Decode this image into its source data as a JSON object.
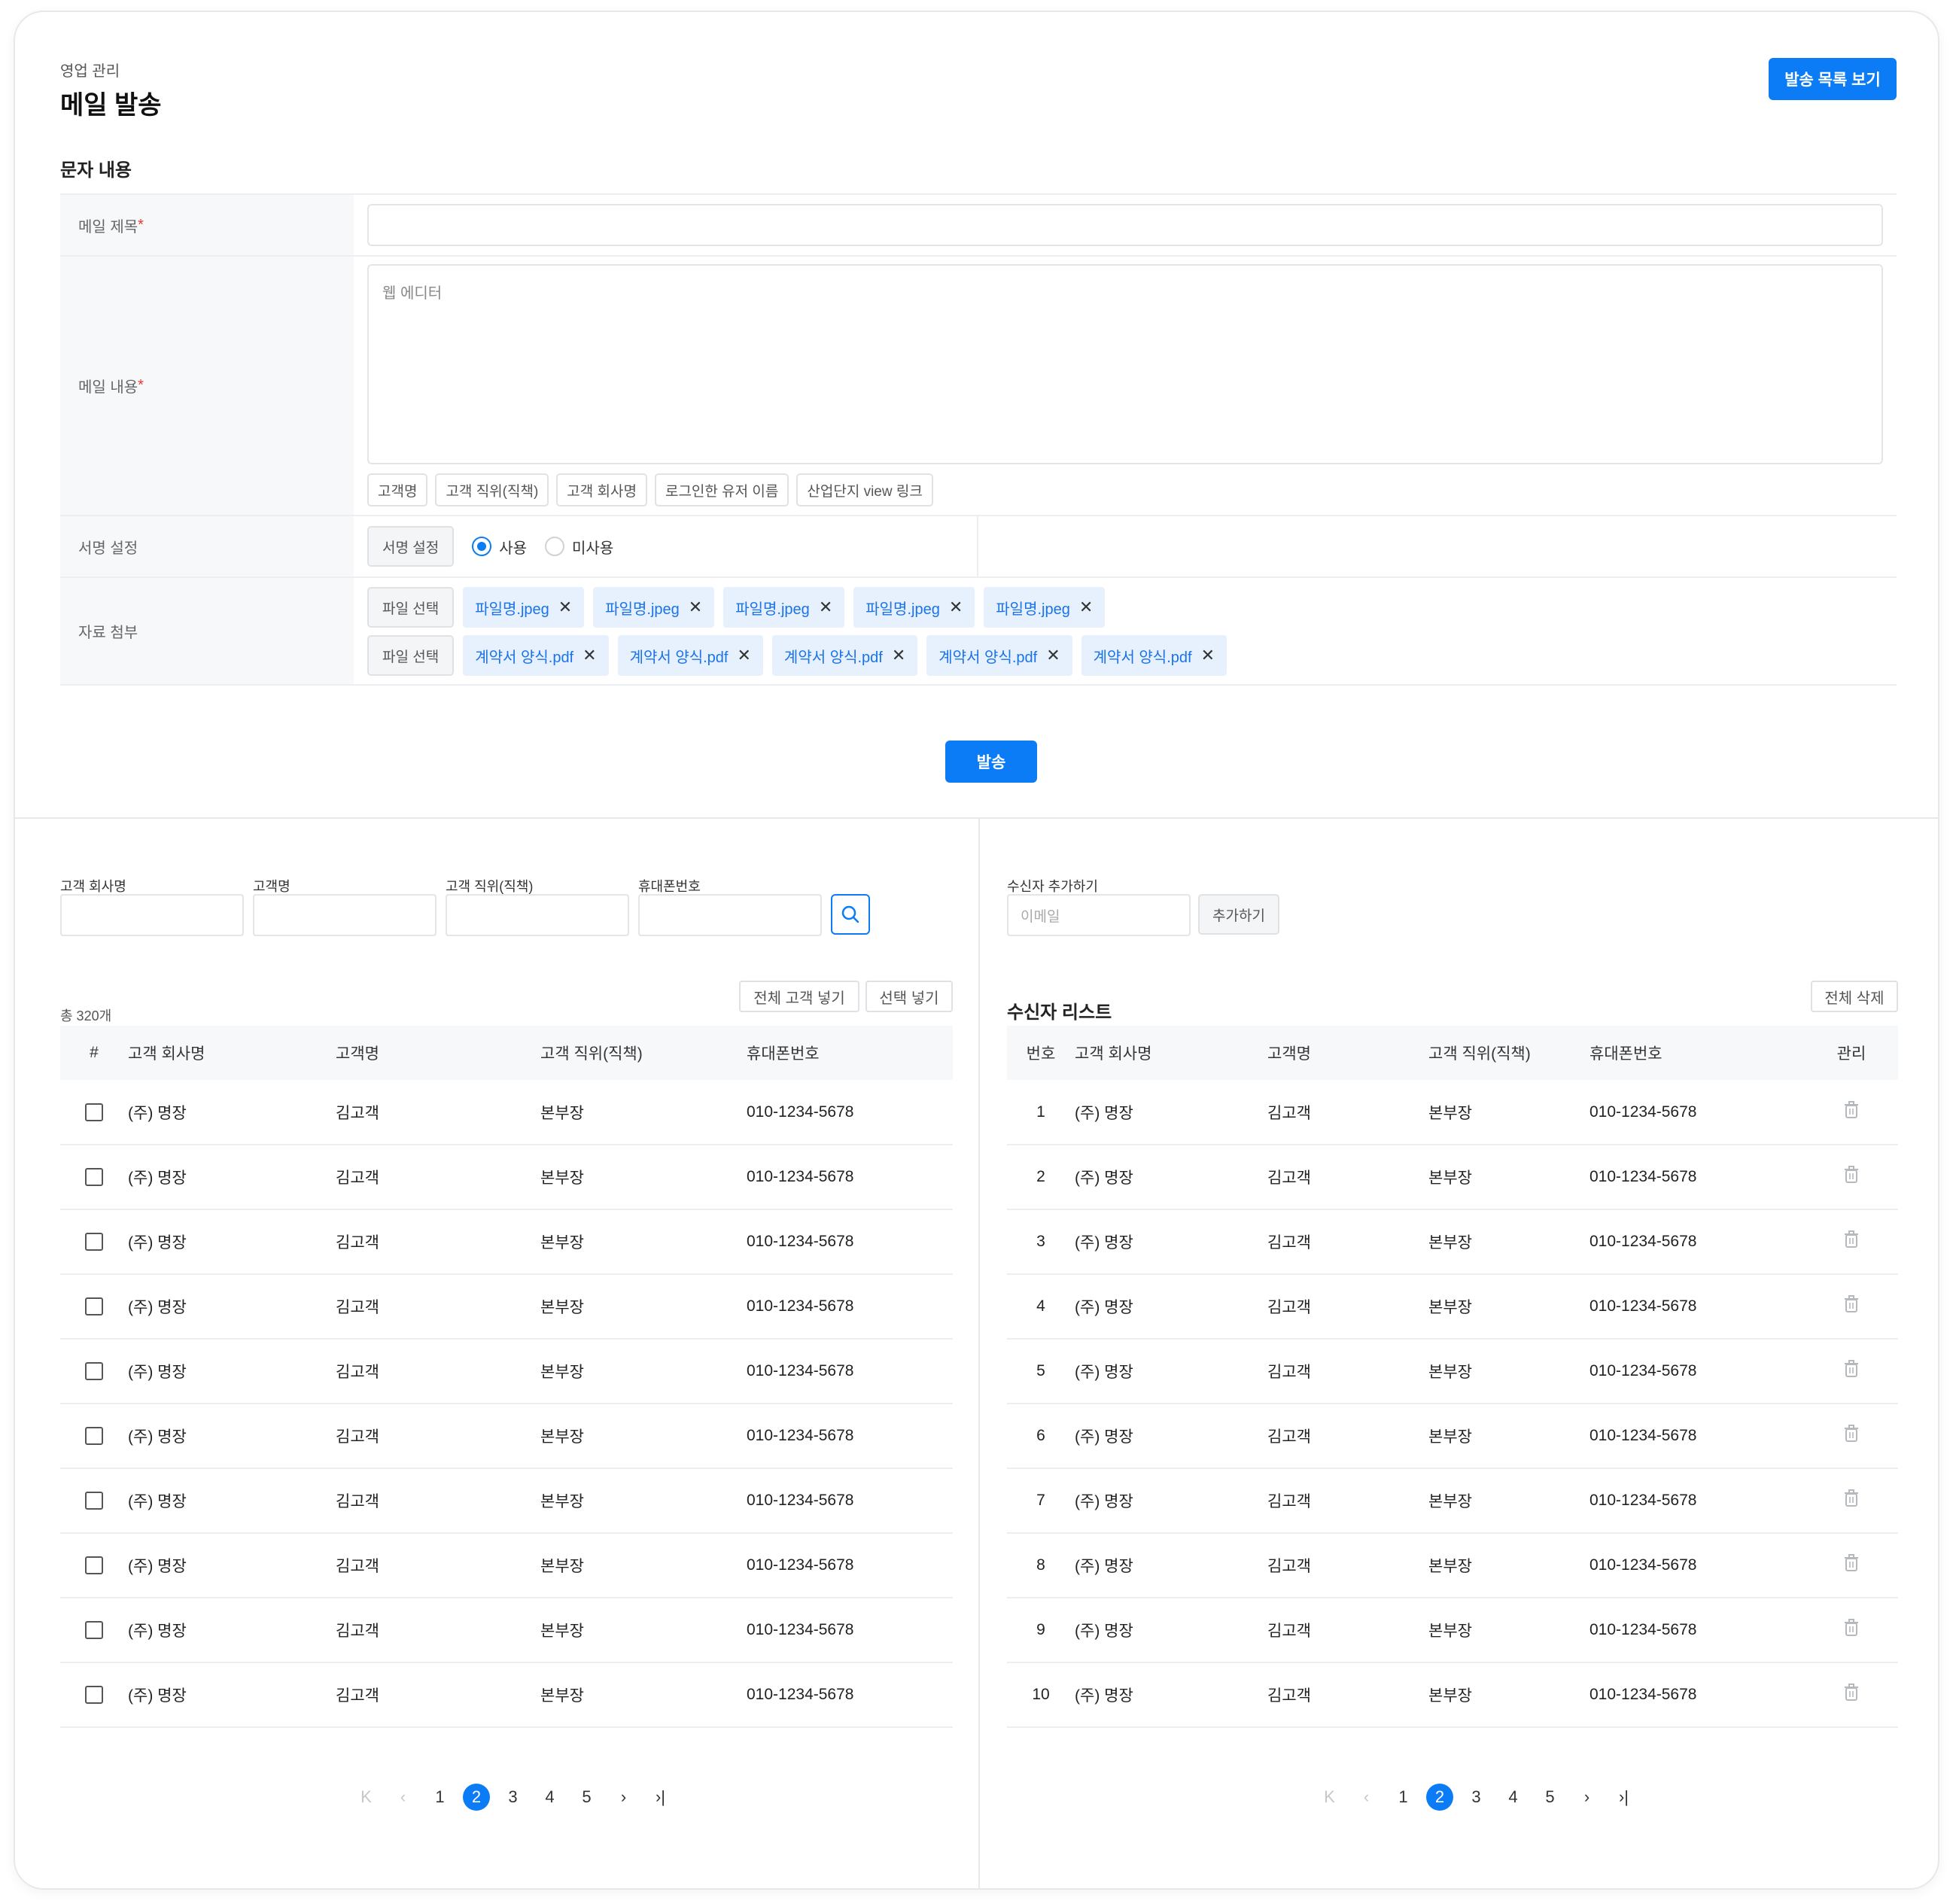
{
  "header": {
    "breadcrumb": "영업 관리",
    "title": "메일 발송",
    "list_button": "발송 목록 보기"
  },
  "form": {
    "section_title": "문자 내용",
    "subject_label": "메일 제목",
    "body_label": "메일 내용",
    "required_mark": "*",
    "editor_placeholder": "웹 에디터",
    "variable_chips": [
      "고객명",
      "고객 직위(직책)",
      "고객 회사명",
      "로그인한 유저 이름",
      "산업단지 view 링크"
    ],
    "signature_label": "서명 설정",
    "signature_button": "서명 설정",
    "signature_options": [
      {
        "label": "사용",
        "selected": true
      },
      {
        "label": "미사용",
        "selected": false
      }
    ],
    "attachment_label": "자료 첨부",
    "file_select_button": "파일 선택",
    "image_files": [
      "파일명.jpeg",
      "파일명.jpeg",
      "파일명.jpeg",
      "파일명.jpeg",
      "파일명.jpeg"
    ],
    "document_files": [
      "계약서 양식.pdf",
      "계약서 양식.pdf",
      "계약서 양식.pdf",
      "계약서 양식.pdf",
      "계약서 양식.pdf"
    ],
    "remove_symbol": "✕",
    "send_button": "발송"
  },
  "customer_search": {
    "filters": [
      {
        "label": "고객 회사명",
        "value": ""
      },
      {
        "label": "고객명",
        "value": ""
      },
      {
        "label": "고객 직위(직책)",
        "value": ""
      },
      {
        "label": "휴대폰번호",
        "value": ""
      }
    ],
    "total": "총 320개",
    "add_all_button": "전체 고객 넣기",
    "add_selected_button": "선택 넣기",
    "columns": [
      "#",
      "고객 회사명",
      "고객명",
      "고객 직위(직책)",
      "휴대폰번호"
    ],
    "rows": [
      {
        "company": "(주) 명장",
        "name": "김고객",
        "position": "본부장",
        "phone": "010-1234-5678",
        "checked": false
      },
      {
        "company": "(주) 명장",
        "name": "김고객",
        "position": "본부장",
        "phone": "010-1234-5678",
        "checked": false
      },
      {
        "company": "(주) 명장",
        "name": "김고객",
        "position": "본부장",
        "phone": "010-1234-5678",
        "checked": false
      },
      {
        "company": "(주) 명장",
        "name": "김고객",
        "position": "본부장",
        "phone": "010-1234-5678",
        "checked": false
      },
      {
        "company": "(주) 명장",
        "name": "김고객",
        "position": "본부장",
        "phone": "010-1234-5678",
        "checked": false
      },
      {
        "company": "(주) 명장",
        "name": "김고객",
        "position": "본부장",
        "phone": "010-1234-5678",
        "checked": false
      },
      {
        "company": "(주) 명장",
        "name": "김고객",
        "position": "본부장",
        "phone": "010-1234-5678",
        "checked": false
      },
      {
        "company": "(주) 명장",
        "name": "김고객",
        "position": "본부장",
        "phone": "010-1234-5678",
        "checked": false
      },
      {
        "company": "(주) 명장",
        "name": "김고객",
        "position": "본부장",
        "phone": "010-1234-5678",
        "checked": false
      },
      {
        "company": "(주) 명장",
        "name": "김고객",
        "position": "본부장",
        "phone": "010-1234-5678",
        "checked": false
      }
    ],
    "pagination": {
      "first": "K",
      "prev": "‹",
      "pages": [
        "1",
        "2",
        "3",
        "4",
        "5"
      ],
      "current": "2",
      "next": "›",
      "last": "›|"
    }
  },
  "recipients": {
    "add_label": "수신자 추가하기",
    "email_placeholder": "이메일",
    "add_button": "추가하기",
    "list_title": "수신자 리스트",
    "delete_all_button": "전체 삭제",
    "columns": [
      "번호",
      "고객 회사명",
      "고객명",
      "고객 직위(직책)",
      "휴대폰번호",
      "관리"
    ],
    "rows": [
      {
        "no": "1",
        "company": "(주) 명장",
        "name": "김고객",
        "position": "본부장",
        "phone": "010-1234-5678"
      },
      {
        "no": "2",
        "company": "(주) 명장",
        "name": "김고객",
        "position": "본부장",
        "phone": "010-1234-5678"
      },
      {
        "no": "3",
        "company": "(주) 명장",
        "name": "김고객",
        "position": "본부장",
        "phone": "010-1234-5678"
      },
      {
        "no": "4",
        "company": "(주) 명장",
        "name": "김고객",
        "position": "본부장",
        "phone": "010-1234-5678"
      },
      {
        "no": "5",
        "company": "(주) 명장",
        "name": "김고객",
        "position": "본부장",
        "phone": "010-1234-5678"
      },
      {
        "no": "6",
        "company": "(주) 명장",
        "name": "김고객",
        "position": "본부장",
        "phone": "010-1234-5678"
      },
      {
        "no": "7",
        "company": "(주) 명장",
        "name": "김고객",
        "position": "본부장",
        "phone": "010-1234-5678"
      },
      {
        "no": "8",
        "company": "(주) 명장",
        "name": "김고객",
        "position": "본부장",
        "phone": "010-1234-5678"
      },
      {
        "no": "9",
        "company": "(주) 명장",
        "name": "김고객",
        "position": "본부장",
        "phone": "010-1234-5678"
      },
      {
        "no": "10",
        "company": "(주) 명장",
        "name": "김고객",
        "position": "본부장",
        "phone": "010-1234-5678"
      }
    ],
    "row_action_icon": "trash-icon",
    "pagination": {
      "first": "K",
      "prev": "‹",
      "pages": [
        "1",
        "2",
        "3",
        "4",
        "5"
      ],
      "current": "2",
      "next": "›",
      "last": "›|"
    }
  },
  "colors": {
    "accent": "#0b7cf5",
    "chip_bg": "#e7f1fd",
    "chip_text": "#1a73e8",
    "required": "#e53935"
  }
}
